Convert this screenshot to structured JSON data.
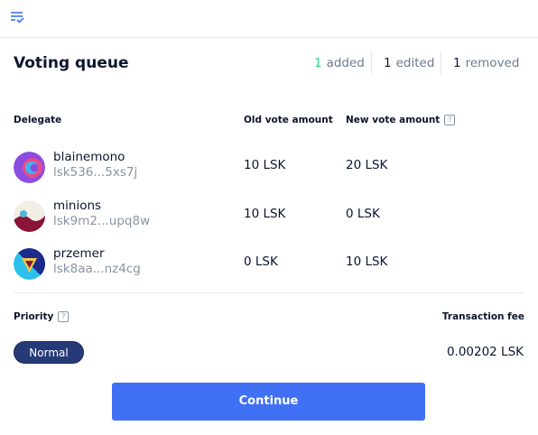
{
  "title": "Voting queue",
  "summary": {
    "added": {
      "count": "1",
      "label": "added"
    },
    "edited": {
      "count": "1",
      "label": "edited"
    },
    "removed": {
      "count": "1",
      "label": "removed"
    }
  },
  "columns": {
    "delegate": "Delegate",
    "old_vote": "Old vote amount",
    "new_vote": "New vote amount"
  },
  "rows": [
    {
      "name": "blainemono",
      "address": "lsk536...5xs7j",
      "old": "10 LSK",
      "new": "20 LSK"
    },
    {
      "name": "minions",
      "address": "lsk9m2...upq8w",
      "old": "10 LSK",
      "new": "0 LSK"
    },
    {
      "name": "przemer",
      "address": "lsk8aa...nz4cg",
      "old": "0 LSK",
      "new": "10 LSK"
    }
  ],
  "priority": {
    "label": "Priority",
    "selected": "Normal"
  },
  "transaction_fee": {
    "label": "Transaction fee",
    "value": "0.00202 LSK"
  },
  "continue_label": "Continue",
  "colors": {
    "accent": "#4070f4",
    "added": "#2bd67b",
    "pill": "#253a77"
  },
  "icons": {
    "topbar": "voting-queue-icon"
  }
}
